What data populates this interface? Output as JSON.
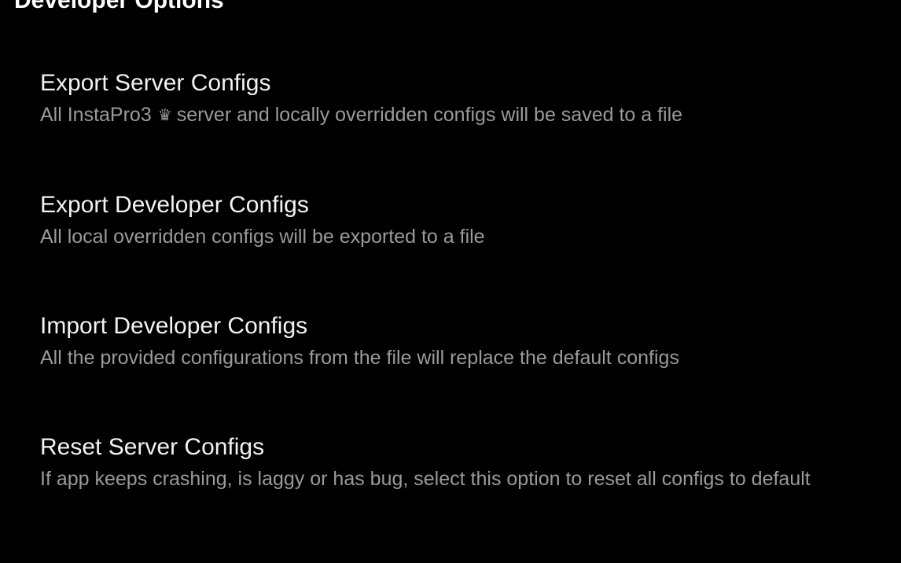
{
  "header": {
    "title": "Developer Options"
  },
  "items": [
    {
      "title": "Export Server Configs",
      "desc_before_icon": "All InstaPro3",
      "icon": "crown-icon",
      "desc_after_icon": "server and locally overridden configs will be saved to a file"
    },
    {
      "title": "Export Developer Configs",
      "desc": "All local overridden configs will be exported to a file"
    },
    {
      "title": "Import Developer Configs",
      "desc": "All the provided configurations from the file will replace the default configs"
    },
    {
      "title": "Reset Server Configs",
      "desc": "If app keeps crashing, is laggy or has bug, select this option to reset all configs to default"
    }
  ],
  "colors": {
    "background": "#000000",
    "title": "#f2f2f2",
    "description": "#9a9a9a"
  }
}
